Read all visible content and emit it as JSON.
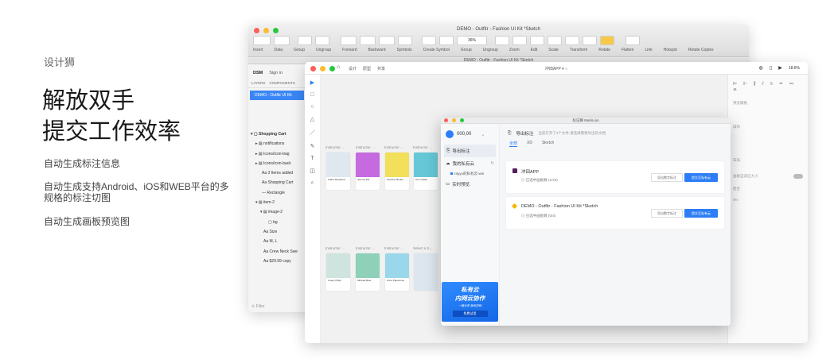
{
  "hero": {
    "brand": "设计狮",
    "headline_1": "解放双手",
    "headline_2": "提交工作效率",
    "feature_1": "自动生成标注信息",
    "feature_2": "自动生成支持Android、iOS和WEB平台的多规格的标注切图",
    "feature_3": "自动生成画板预览图"
  },
  "sketch": {
    "window_title": "DEMO - Outfitr - Fashion UI Kit *Sketch",
    "doc_tab": "DEMO - Outfitr - Fashion UI Kit *Sketch",
    "toolbar_labels": [
      "Insert",
      "Data",
      "Group",
      "Ungroup",
      "Forward",
      "Backward",
      "Symbols",
      "Create Symbol",
      "Group",
      "Ungroup",
      "Zoom",
      "Edit",
      "Scale",
      "Transform",
      "Rotate",
      "Flatten",
      "Link",
      "Hotspot",
      "Rotate Copies"
    ],
    "zoom": "36%",
    "panel_tabs": [
      "DSM",
      "Sign in"
    ],
    "panel_subtabs": [
      "LAYERS",
      "COMPONENTS"
    ],
    "selected_page": "DEMO - Outfitr UI Kit",
    "layers": [
      "Shopping Cart",
      "notifications",
      "Icons/icon-bag",
      "Icons/icon-back",
      "3 Items added",
      "Shopping Cart",
      "Rectangle",
      "item-2",
      "image-2",
      "bg",
      "Size",
      "M, L",
      "Crew Neck Swe",
      "$29.99 copy"
    ],
    "filter": "Filter"
  },
  "app2": {
    "tabs": [
      "设计",
      "原型",
      "共享"
    ],
    "title": "冲田APP ▾ ○",
    "zoom": "18.6%",
    "artboard_label": "Instructor ...",
    "artboard_label_last": "Select a S...",
    "card_names": [
      "Claire Shepherd",
      "Jerome Pitt",
      "Harrison Broker",
      "Tom Fawks",
      "Casey Philip",
      "Michael Blue",
      "Anne Papavonia"
    ],
    "right_labels": [
      "预览模板",
      "操作",
      "布局",
      "画板自适应大小",
      "结合",
      "0%"
    ]
  },
  "marklion": {
    "title": "标记狮 MarkLion",
    "account": "000,00",
    "nav_export": "导出标注",
    "nav_cloud": "我的私有云",
    "nav_sub": "rayyu的私有云-win",
    "nav_preview": "实时预览",
    "promo_1": "私有云",
    "promo_2": "内网云协作",
    "promo_3": "一键分享  版本控制",
    "promo_btn": "免费试用",
    "head_title": "导出标注",
    "head_sub": "当前打开了2个文件,请选择需要导出的文档",
    "tabs": [
      "全部",
      "XD",
      "Sketch"
    ],
    "items": [
      {
        "name": "冲田APP",
        "meta": "已选中画板数 (1/43)",
        "btn_1": "导出数字标注",
        "btn_2": "提交至私有云"
      },
      {
        "name": "DEMO - Outfitr - Fashion UI Kit *Sketch",
        "meta": "已选中画板数 (0/4)",
        "btn_1": "导出数字标注",
        "btn_2": "提交至私有云"
      }
    ]
  },
  "colors": {
    "accent": "#2d7ef6",
    "promo": "#1f7af0"
  }
}
